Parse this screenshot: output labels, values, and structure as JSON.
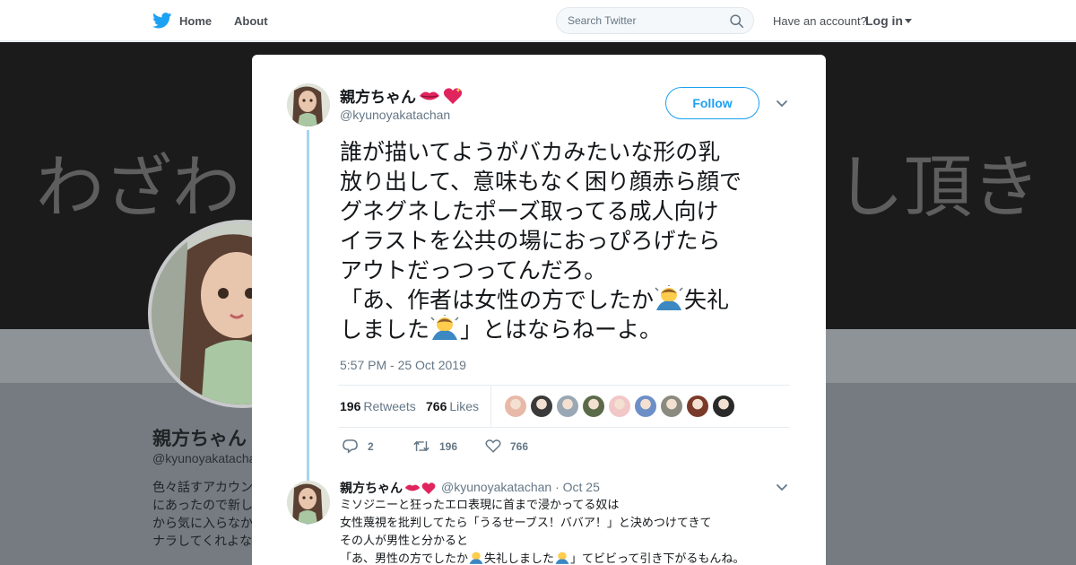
{
  "nav": {
    "home_label": "Home",
    "about_label": "About",
    "search_placeholder": "Search Twitter",
    "have_account": "Have an account?",
    "login_label": "Log in"
  },
  "background_profile": {
    "banner_left": "わざわ",
    "banner_right": "し頂き",
    "name": "親方ちゃん",
    "handle": "@kyunoyakatachan",
    "bio_lines": [
      "色々話すアカウン",
      "にあったので新し",
      "から気に入らなか",
      "ナラしてくれよな"
    ]
  },
  "tweet": {
    "author_name": "親方ちゃん",
    "author_handle": "@kyunoyakatachan",
    "follow_label": "Follow",
    "text_lines": [
      "誰が描いてようがバカみたいな形の乳",
      "放り出して、意味もなく困り顔赤ら顔で",
      "グネグネしたポーズ取ってる成人向け",
      "イラストを公共の場におっぴろげたら",
      "アウトだっつってんだろ。",
      "「あ、作者は女性の方でしたか",
      "失礼",
      "しました",
      "」とはならねーよ。"
    ],
    "timestamp": "5:57 PM - 25 Oct 2019",
    "retweets_count": "196",
    "retweets_label": "Retweets",
    "likes_count": "766",
    "likes_label": "Likes",
    "action_reply_count": "2",
    "action_retweet_count": "196",
    "action_like_count": "766",
    "liker_colors": [
      "#e8b9a8",
      "#3a3a3a",
      "#9aa7b4",
      "#5b6b4a",
      "#f1c7c7",
      "#6d8fc7",
      "#8a8a80",
      "#7a3a2a",
      "#2a2a2a"
    ]
  },
  "reply": {
    "author_name": "親方ちゃん",
    "author_handle": "@kyunoyakatachan",
    "separator": "·",
    "date": "Oct 25",
    "text_lines": [
      "ミソジニーと狂ったエロ表現に首まで浸かってる奴は",
      "女性蔑視を批判してたら「うるせーブス！ババア！」と決めつけてきて",
      "その人が男性と分かると",
      "「あ、男性の方でしたか",
      "失礼しました",
      "」てビビって引き下がるもんね。"
    ]
  },
  "colors": {
    "twitter_blue": "#1da1f2",
    "thread_line": "#a8d3f0",
    "muted_text": "#657786"
  }
}
